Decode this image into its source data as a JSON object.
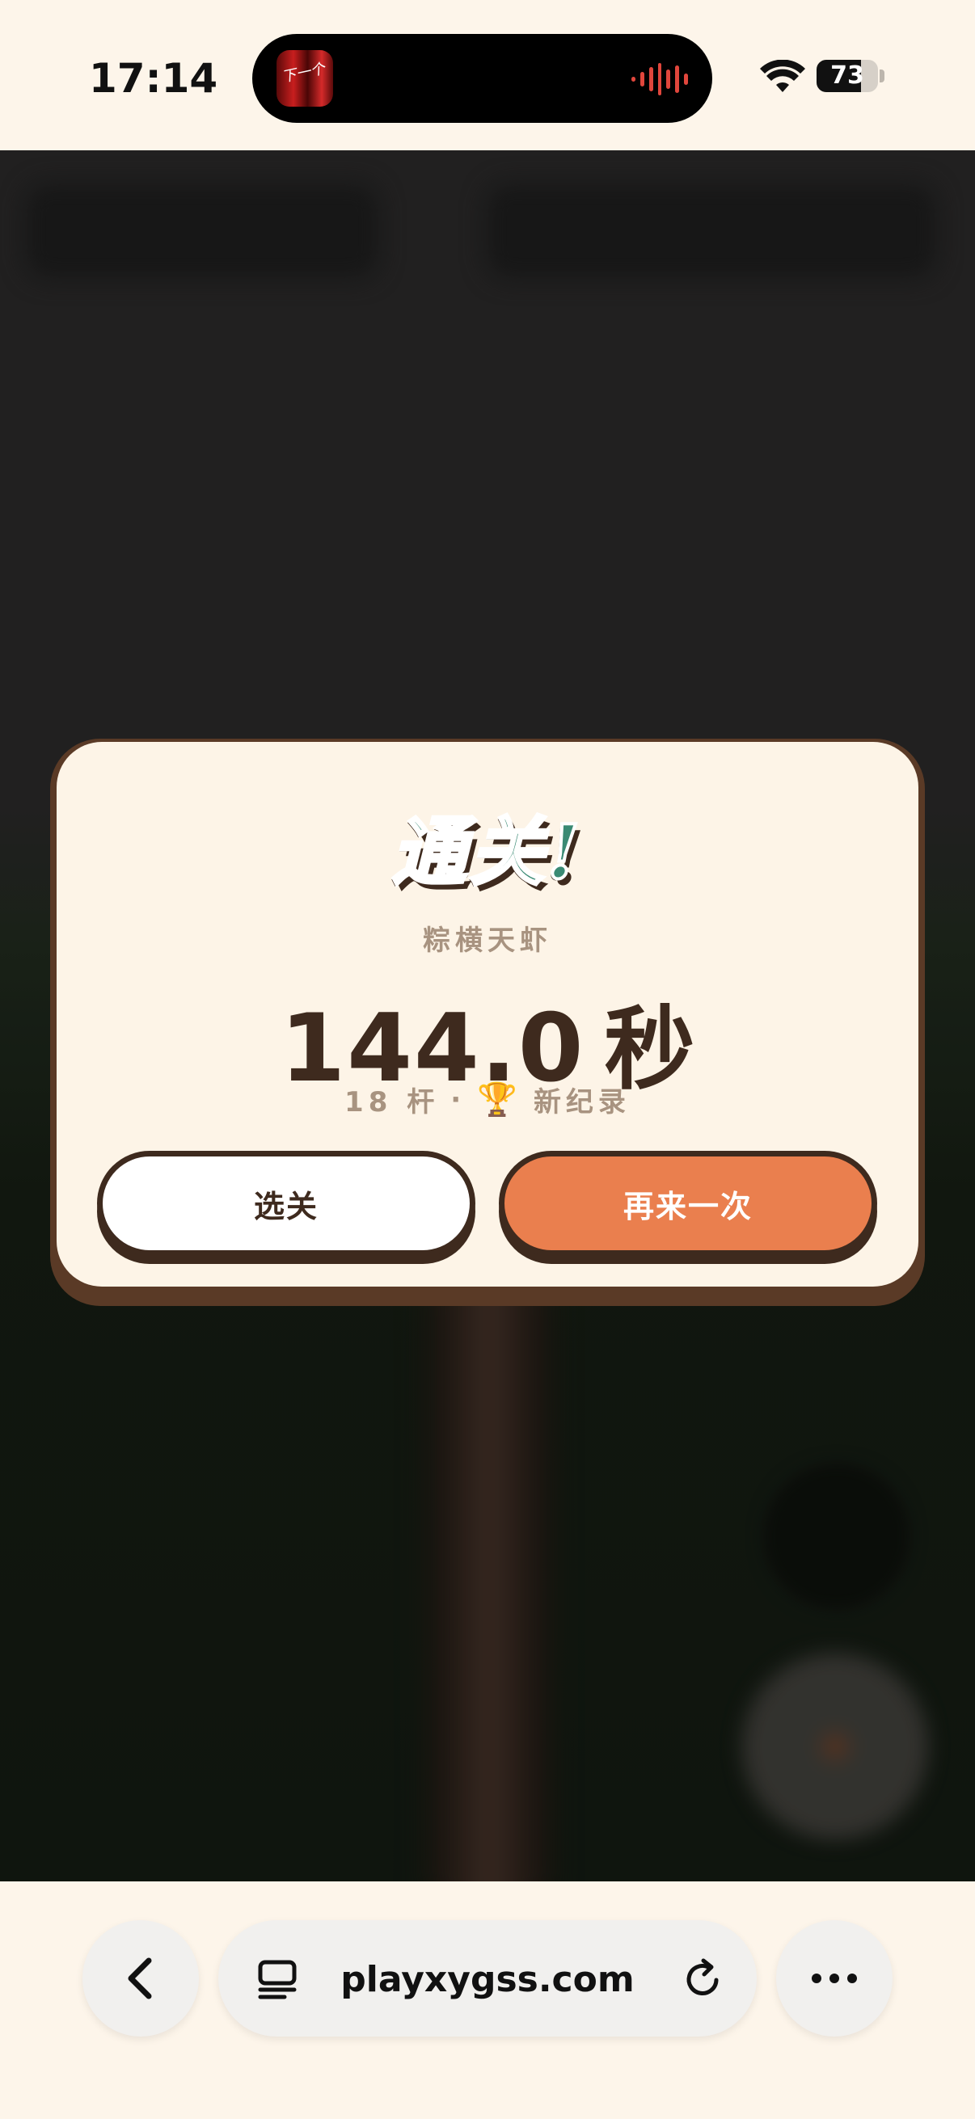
{
  "status_bar": {
    "time": "17:14",
    "battery": "73",
    "island_app_text": "下一个"
  },
  "dialog": {
    "title": "通关!",
    "level_name": "粽横天虾",
    "time_value": "144.0",
    "time_unit": "秒",
    "strokes": "18 杆",
    "separator": "·",
    "record_label": "新纪录",
    "select_button": "选关",
    "retry_button": "再来一次"
  },
  "browser": {
    "url": "playxygss.com"
  },
  "icons": {
    "back": "chevron-left-icon",
    "tabs": "tabs-icon",
    "reload": "reload-icon",
    "more": "more-icon",
    "trophy": "trophy-icon",
    "wifi": "wifi-icon"
  },
  "colors": {
    "title_green": "#3a8a74",
    "dark_brown": "#3e2a1e",
    "retry_orange": "#ea7f4e",
    "cream": "#fdf4e7",
    "muted_text": "#a89380"
  }
}
